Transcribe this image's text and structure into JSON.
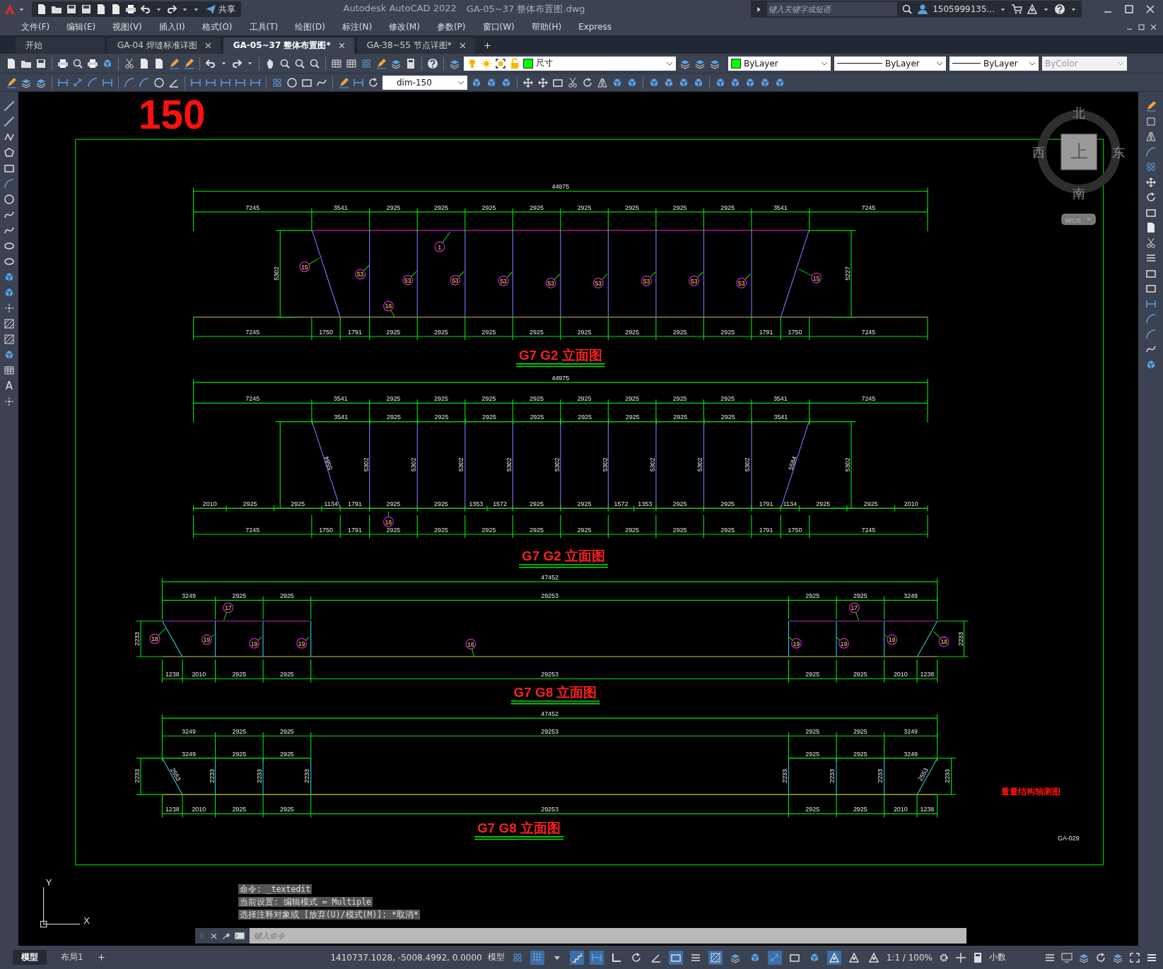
{
  "title_bar": {
    "share": "共享",
    "app_title": "Autodesk AutoCAD 2022",
    "file_name": "GA-05~37 整体布置图.dwg",
    "search": {
      "placeholder": "键入关键字或短语"
    },
    "user": "1505999135..."
  },
  "menu": [
    "文件(F)",
    "编辑(E)",
    "视图(V)",
    "插入(I)",
    "格式(O)",
    "工具(T)",
    "绘图(D)",
    "标注(N)",
    "修改(M)",
    "参数(P)",
    "窗口(W)",
    "帮助(H)",
    "Express"
  ],
  "file_tabs": [
    {
      "label": "开始",
      "selected": false,
      "closable": false
    },
    {
      "label": "GA-04 焊缝标准详图",
      "selected": false,
      "closable": true
    },
    {
      "label": "GA-05~37 整体布置图*",
      "selected": true,
      "closable": true
    },
    {
      "label": "GA-38~55 节点详图*",
      "selected": false,
      "closable": true
    }
  ],
  "properties": {
    "layer": "尺寸",
    "object_color": "ByLayer",
    "linetype": "ByLayer",
    "lineweight": "ByLayer",
    "plot_style": "ByColor",
    "plot_style_disabled": true
  },
  "dim_style": "dim-150",
  "text_tool": "A",
  "drawings": [
    {
      "title": "G7 G2 立面图",
      "dimension_rows": [
        [
          "44975"
        ],
        [
          "7245",
          "3541",
          "2925",
          "2925",
          "2925",
          "2925",
          "2925",
          "2925",
          "2925",
          "2925",
          "3541",
          "7245"
        ],
        [
          "7245",
          "1750",
          "1791",
          "2925",
          "2925",
          "2925",
          "2925",
          "2925",
          "2925",
          "2925",
          "2925",
          "1791",
          "1750",
          "7245"
        ]
      ],
      "vertical_dimensions": [
        "5302",
        "5227"
      ],
      "callouts": [
        "15",
        "53",
        "53",
        "53",
        "53",
        "53",
        "53",
        "53",
        "53",
        "53",
        "1",
        "16",
        "15"
      ]
    },
    {
      "title": "G7 G2 立面图",
      "dimension_rows": [
        [
          "44975"
        ],
        [
          "7245",
          "3541",
          "2925",
          "2925",
          "2925",
          "2925",
          "2925",
          "2925",
          "2925",
          "2925",
          "3541",
          "7245"
        ],
        [
          "3541",
          "2925",
          "2925",
          "2925",
          "2925",
          "2925",
          "2925",
          "2925",
          "2925",
          "3541"
        ],
        [
          "2010",
          "2925",
          "2925",
          "1134",
          "1791",
          "2925",
          "2925",
          "1353",
          "1572",
          "2925",
          "2925",
          "1572",
          "1353",
          "2925",
          "2925",
          "1791",
          "1134",
          "2925",
          "2925",
          "2010"
        ],
        [
          "7245",
          "1750",
          "1791",
          "2925",
          "2925",
          "2925",
          "2925",
          "2925",
          "2925",
          "2925",
          "2925",
          "1791",
          "1750",
          "7245"
        ]
      ],
      "vertical_dimensions": [
        "5584",
        "5302",
        "5302",
        "5302",
        "5302",
        "5302",
        "5302",
        "5302",
        "5302",
        "5302",
        "5584",
        "5302"
      ],
      "callouts": [
        "16"
      ]
    },
    {
      "title": "G7 G8 立面图",
      "dimension_rows": [
        [
          "47452"
        ],
        [
          "3249",
          "2925",
          "2925",
          "29253",
          "2925",
          "2925",
          "3249"
        ],
        [
          "1238",
          "2010",
          "2925",
          "2925",
          "29253",
          "2925",
          "2925",
          "2010",
          "1238"
        ]
      ],
      "vertical_dimensions": [
        "2233",
        "2233"
      ],
      "callouts": [
        "18",
        "17",
        "19",
        "19",
        "19",
        "16",
        "19",
        "19",
        "17",
        "19",
        "18"
      ]
    },
    {
      "title": "G7 G8 立面图",
      "dimension_rows": [
        [
          "47452"
        ],
        [
          "3249",
          "2925",
          "2925",
          "29253",
          "2925",
          "2925",
          "3249"
        ],
        [
          "3249",
          "2925",
          "2925"
        ],
        [
          "2925",
          "2925",
          "3249"
        ],
        [
          "1238",
          "2010",
          "2925",
          "2925",
          "29253",
          "2925",
          "2925",
          "2010",
          "1238"
        ]
      ],
      "vertical_dimensions": [
        "2233",
        "2553",
        "2233",
        "2233",
        "2233",
        "2233",
        "2233",
        "2233",
        "2553",
        "2233"
      ]
    }
  ],
  "drawing_texts": {
    "big_number": "150",
    "note": "量量结构轴测图",
    "sheet_code": "GA-029"
  },
  "viewcube": {
    "top": "上",
    "north": "北",
    "west": "西",
    "east": "东",
    "south": "南",
    "coord_system": "WCS"
  },
  "ucs": {
    "x": "X",
    "y": "Y"
  },
  "command_line": {
    "history": [
      "命令: _textedit",
      "当前设置: 编辑模式 = Multiple",
      "选择注释对象或 [放弃(U)/模式(M)]: *取消*"
    ],
    "placeholder": "键入命令"
  },
  "layout_tabs": [
    {
      "label": "模型",
      "selected": true
    },
    {
      "label": "布局1",
      "selected": false
    }
  ],
  "status_bar": {
    "coordinates": "1410737.1028, -5008.4992, 0.0000",
    "space": "模型",
    "scale": "1:1 / 100%",
    "units": "小数",
    "toggles": [
      {
        "on": false
      },
      {
        "on": true
      },
      {
        "on": false
      },
      {
        "on": true
      },
      {
        "on": true
      },
      {
        "on": false
      },
      {
        "on": false
      },
      {
        "on": false
      },
      {
        "on": true
      },
      {
        "on": false
      },
      {
        "on": true
      },
      {
        "on": false
      },
      {
        "on": false
      },
      {
        "on": true
      },
      {
        "on": false
      },
      {
        "on": false
      },
      {
        "on": true
      },
      {
        "on": false
      },
      {
        "on": false
      }
    ]
  }
}
